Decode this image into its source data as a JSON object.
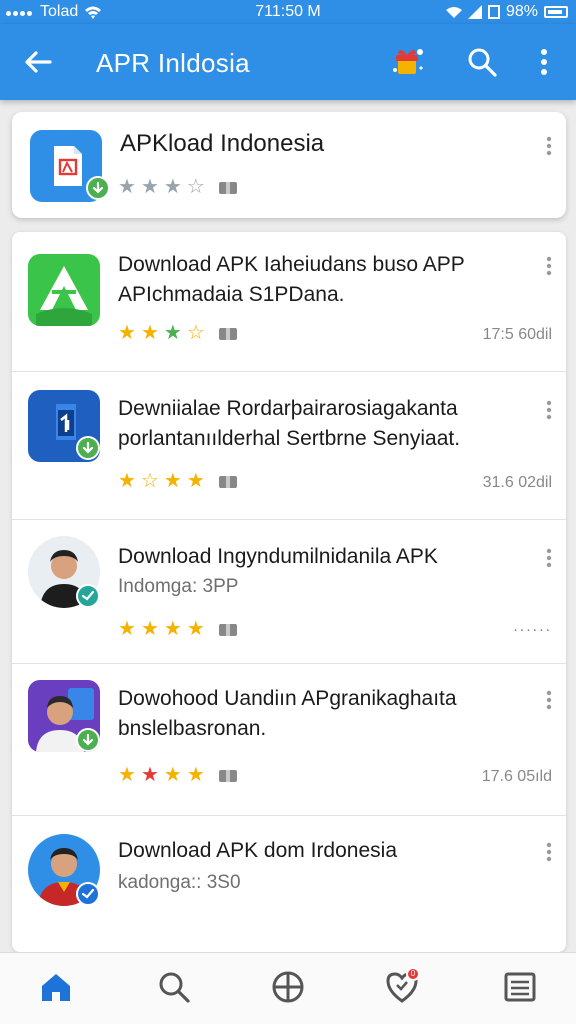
{
  "status_bar": {
    "carrier": "Tolad",
    "time": "711:50 M",
    "battery": "98%"
  },
  "app_bar": {
    "title": "APR Inldosia",
    "back_icon": "arrow-left-icon",
    "promo_icon": "gift-sparkle-icon",
    "search_icon": "search-icon",
    "more_icon": "more-vert-icon"
  },
  "featured": {
    "name": "APKload Indonesia",
    "rating": 3.5,
    "icon": "apk-document-icon",
    "icon_color": "#2f8fe6"
  },
  "apps": [
    {
      "title_line1": "Download APK Iaheiudans buso APP",
      "title_line2": "APIchmadaia S1PDana.",
      "subtitle": "",
      "meta": "17:5 60dil",
      "rating": 3.5,
      "icon": "green-apk-logo-icon"
    },
    {
      "title_line1": "Dewniialae Rordarþairarosiagakanta",
      "title_line2": "porlantanıılderhal Sertbrne Senyiaat.",
      "subtitle": "",
      "meta": "31.6 02dil",
      "rating": 3.5,
      "icon": "blue-apk-logo-icon"
    },
    {
      "title_line1": "Download Ingyndumilnidanila APK",
      "title_line2": "",
      "subtitle": "Indomga: 3PP",
      "meta": "......",
      "rating": 4,
      "icon": "person-avatar-icon"
    },
    {
      "title_line1": "Dowohood Uandiın APgranikaghaıta",
      "title_line2": "bnslelbasronan.",
      "subtitle": "",
      "meta": "17.6 05ıld",
      "rating": 4,
      "icon": "person-avatar-purple-icon"
    },
    {
      "title_line1": "Download APK dom Irdonesia",
      "title_line2": "",
      "subtitle": "kadonga:: 3S0",
      "meta": "",
      "rating": 0,
      "icon": "person-avatar-red-icon"
    }
  ],
  "bottom_nav": [
    {
      "name": "home",
      "icon": "home-icon",
      "active": true
    },
    {
      "name": "search",
      "icon": "search-icon",
      "active": false
    },
    {
      "name": "explore",
      "icon": "crosshair-icon",
      "active": false
    },
    {
      "name": "favorites",
      "icon": "heart-shield-icon",
      "active": false,
      "badge": "0"
    },
    {
      "name": "menu",
      "icon": "list-icon",
      "active": false
    }
  ],
  "colors": {
    "primary": "#2f8fe6",
    "star_gold": "#f5b301",
    "star_green": "#4caf50",
    "star_red": "#e53935",
    "star_gray": "#9aa4ad"
  }
}
